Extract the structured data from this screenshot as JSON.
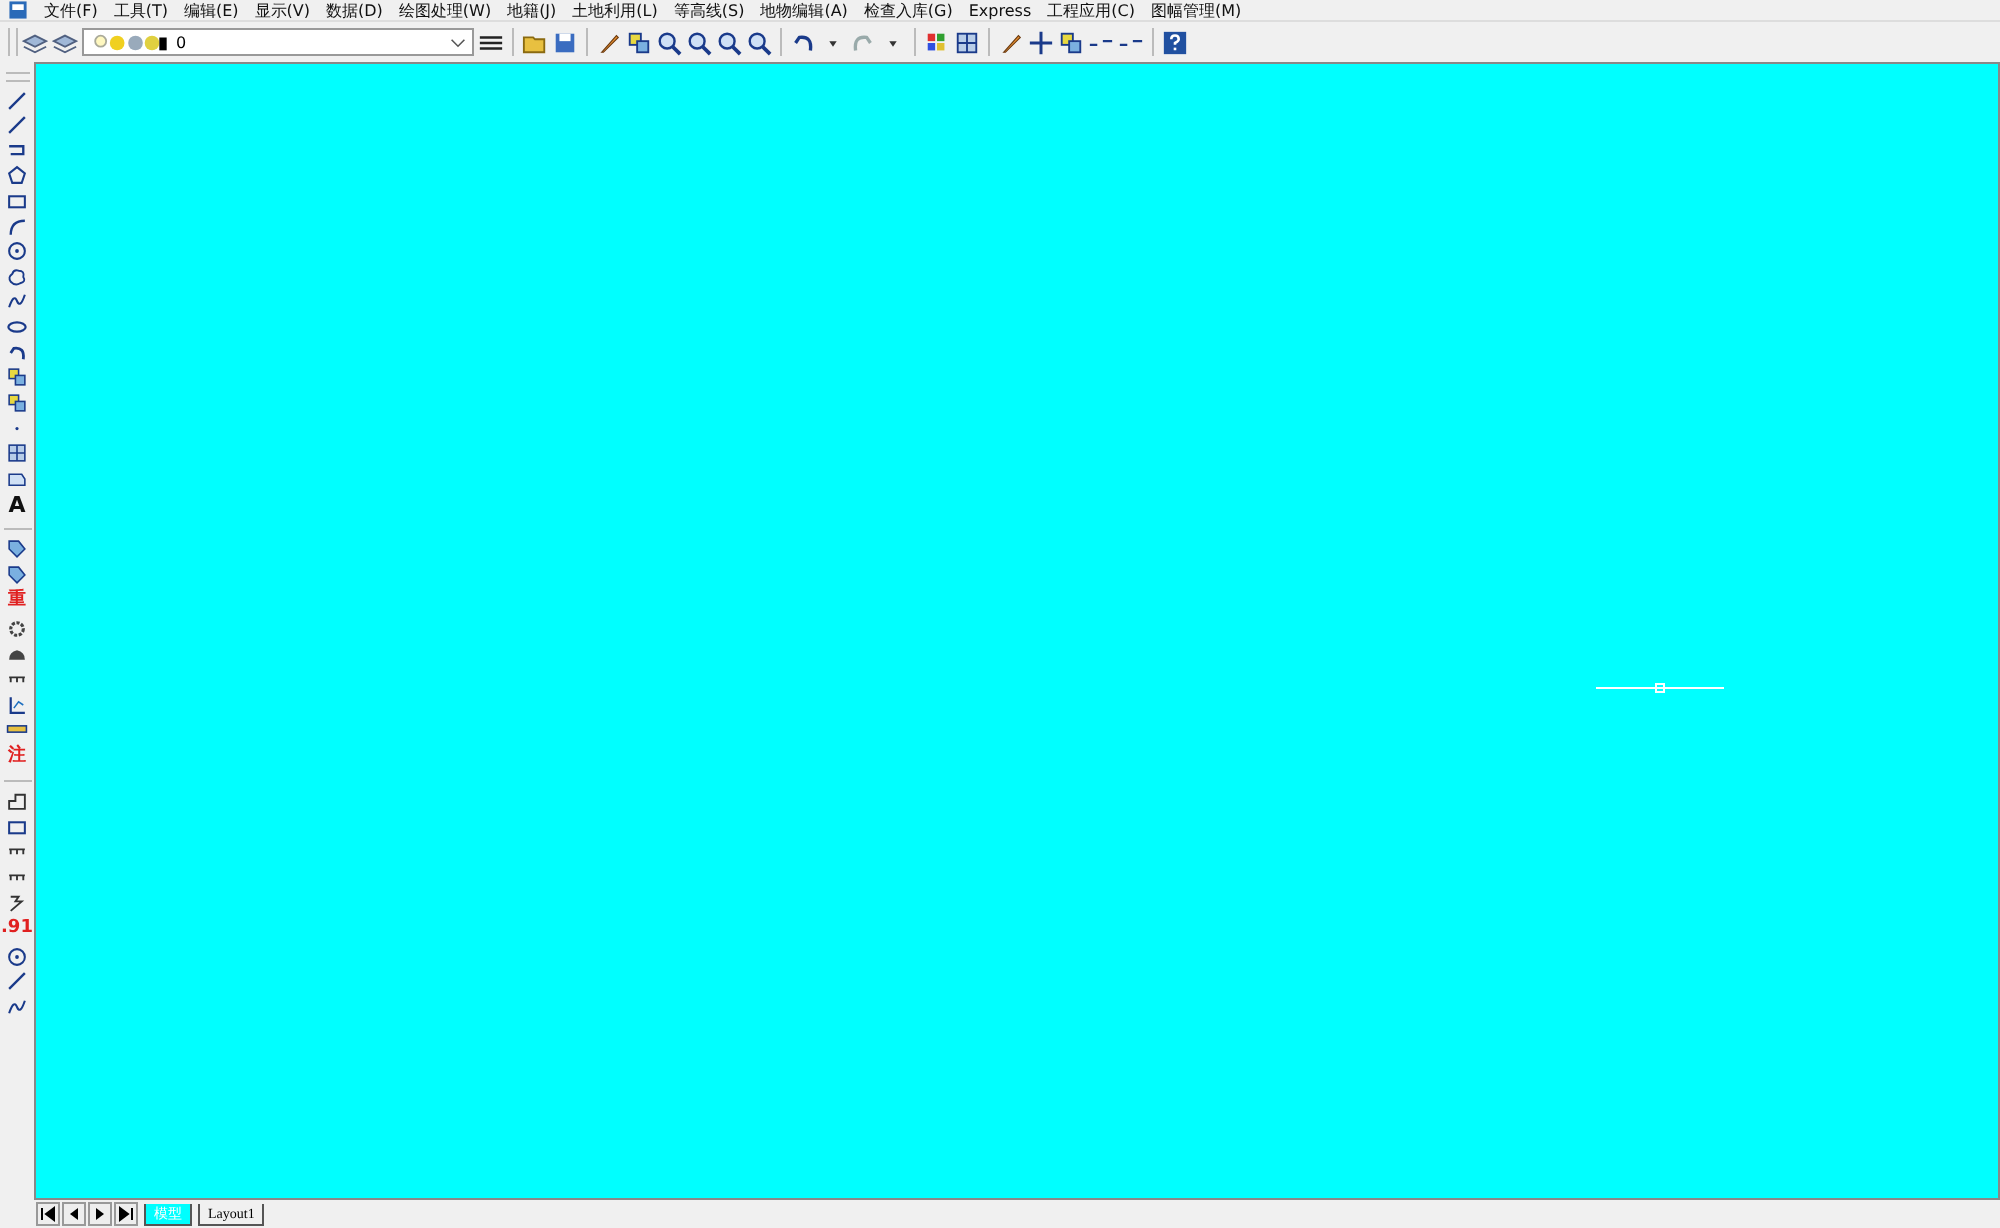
{
  "menu": [
    {
      "label": "文件(F)"
    },
    {
      "label": "工具(T)"
    },
    {
      "label": "编辑(E)"
    },
    {
      "label": "显示(V)"
    },
    {
      "label": "数据(D)"
    },
    {
      "label": "绘图处理(W)"
    },
    {
      "label": "地籍(J)"
    },
    {
      "label": "土地利用(L)"
    },
    {
      "label": "等高线(S)"
    },
    {
      "label": "地物编辑(A)"
    },
    {
      "label": "检查入库(G)"
    },
    {
      "label": "Express"
    },
    {
      "label": "工程应用(C)"
    },
    {
      "label": "图幅管理(M)"
    }
  ],
  "layer_combo": {
    "value": "0"
  },
  "left_text_tools": [
    {
      "label": "A",
      "kind": "plain"
    },
    {
      "label": "重",
      "kind": "red"
    },
    {
      "label": "注",
      "kind": "red"
    },
    {
      "label": ".91",
      "kind": "red"
    }
  ],
  "layout_tabs": [
    {
      "label": "模型",
      "selected": true
    },
    {
      "label": "Layout1",
      "selected": false
    }
  ]
}
